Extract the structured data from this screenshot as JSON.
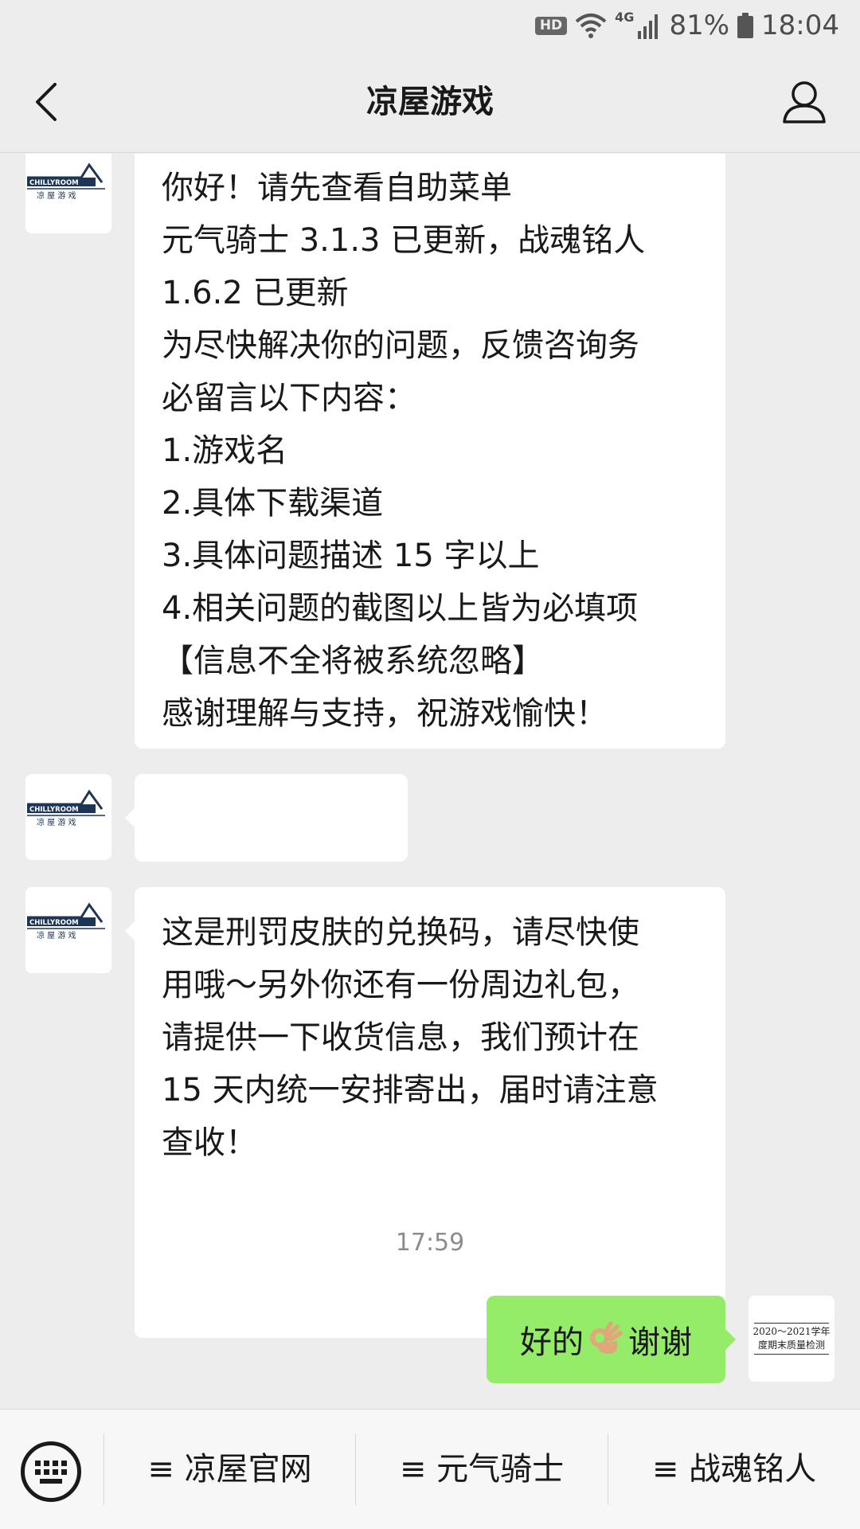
{
  "status_bar": {
    "hd": "HD",
    "network": "4G",
    "battery": "81%",
    "time": "18:04"
  },
  "header": {
    "title": "凉屋游戏",
    "back_icon": "chevron-left-icon",
    "profile_icon": "person-icon"
  },
  "avatar": {
    "brand": "CHILLYROOM",
    "caption": "凉 屋 游 戏"
  },
  "messages": [
    {
      "sender": "official",
      "text": "你好！请先查看自助菜单\n元气骑士 3.1.3 已更新，战魂铭人\n1.6.2 已更新\n为尽快解决你的问题，反馈咨询务\n必留言以下内容：\n1.游戏名\n2.具体下载渠道\n3.具体问题描述 15 字以上\n4.相关问题的截图以上皆为必填项\n【信息不全将被系统忽略】\n感谢理解与支持，祝游戏愉快！"
    },
    {
      "sender": "official",
      "redacted": true
    },
    {
      "sender": "official",
      "text": "这是刑罚皮肤的兑换码，请尽快使\n用哦～另外你还有一份周边礼包，\n请提供一下收货信息，我们预计在\n15 天内统一安排寄出，届时请注意\n查收！"
    }
  ],
  "timestamp": "17:59",
  "sent": {
    "text_before": "好的",
    "emoji": "ok-hand-icon",
    "text_after": "谢谢"
  },
  "my_avatar": {
    "line1": "2020～2021学年",
    "line2": "度期末质量检测"
  },
  "bottom_menu": {
    "keyboard_icon": "keyboard-icon",
    "items": [
      {
        "label": "≡ 凉屋官网"
      },
      {
        "label": "≡ 元气骑士"
      },
      {
        "label": "≡ 战魂铭人"
      }
    ]
  }
}
